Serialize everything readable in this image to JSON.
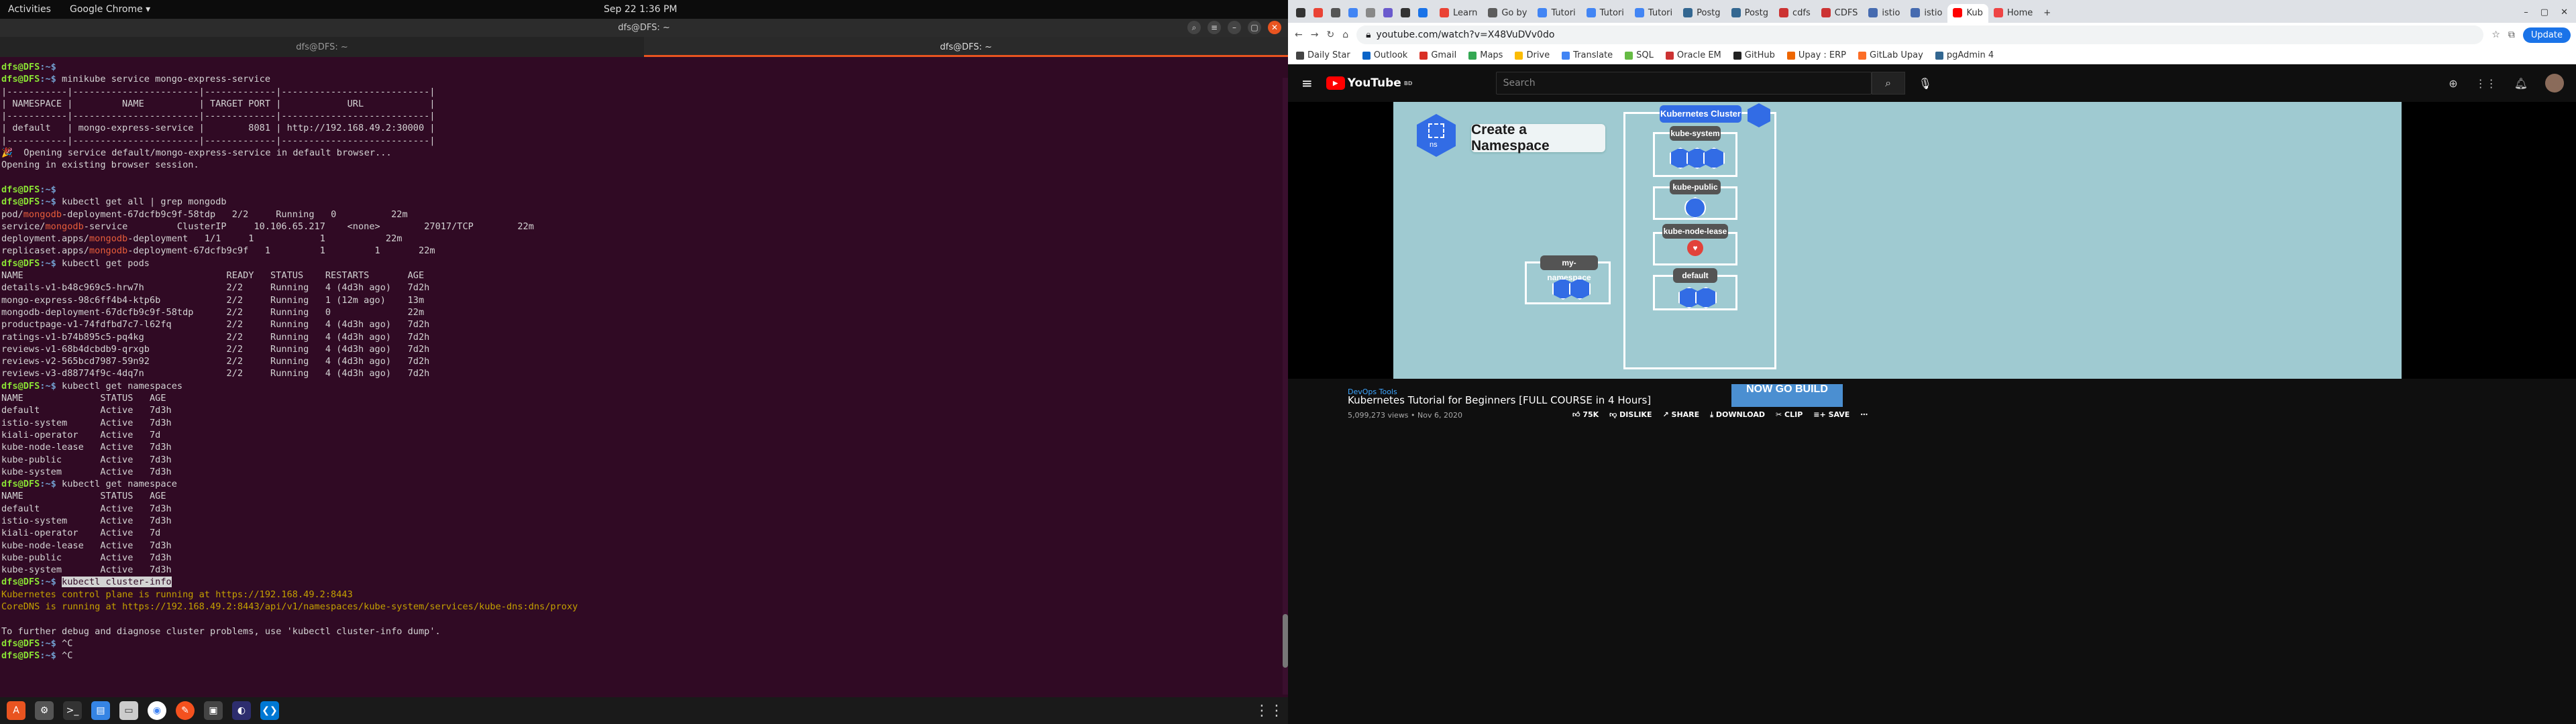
{
  "topbar": {
    "activities": "Activities",
    "app": "Google Chrome ▾",
    "clock": "Sep 22  1:36 PM",
    "tray": "●"
  },
  "terminal": {
    "title": "dfs@DFS: ~",
    "tabs": [
      "dfs@DFS: ~",
      "dfs@DFS: ~"
    ],
    "prompt_user": "dfs@DFS",
    "prompt_path": ":~$",
    "lines": [
      {
        "p": true,
        "cmd": ""
      },
      {
        "p": true,
        "cmd": " minikube service mongo-express-service"
      },
      {
        "t": "|-----------|-----------------------|-------------|---------------------------|"
      },
      {
        "t": "| NAMESPACE |         NAME          | TARGET PORT |            URL            |"
      },
      {
        "t": "|-----------|-----------------------|-------------|---------------------------|"
      },
      {
        "t": "| default   | mongo-express-service |        8081 | http://192.168.49.2:30000 |"
      },
      {
        "t": "|-----------|-----------------------|-------------|---------------------------|"
      },
      {
        "t": "🎉  Opening service default/mongo-express-service in default browser..."
      },
      {
        "t": "Opening in existing browser session."
      },
      {
        "t": ""
      },
      {
        "p": true,
        "cmd": ""
      },
      {
        "p": true,
        "cmd": " kubectl get all | grep mongodb"
      },
      {
        "t": "pod/{mongodb}-deployment-67dcfb9c9f-58tdp   2/2     Running   0          22m"
      },
      {
        "t": "service/{mongodb}-service         ClusterIP     10.106.65.217    <none>        27017/TCP        22m"
      },
      {
        "t": "deployment.apps/{mongodb}-deployment   1/1     1            1           22m"
      },
      {
        "t": "replicaset.apps/{mongodb}-deployment-67dcfb9c9f   1         1         1       22m"
      },
      {
        "p": true,
        "cmd": " kubectl get pods"
      },
      {
        "t": "NAME                                     READY   STATUS    RESTARTS       AGE"
      },
      {
        "t": "details-v1-b48c969c5-hrw7h               2/2     Running   4 (4d3h ago)   7d2h"
      },
      {
        "t": "mongo-express-98c6ff4b4-ktp6b            2/2     Running   1 (12m ago)    13m"
      },
      {
        "t": "mongodb-deployment-67dcfb9c9f-58tdp      2/2     Running   0              22m"
      },
      {
        "t": "productpage-v1-74fdfbd7c7-l62fq          2/2     Running   4 (4d3h ago)   7d2h"
      },
      {
        "t": "ratings-v1-b74b895c5-pq4kg               2/2     Running   4 (4d3h ago)   7d2h"
      },
      {
        "t": "reviews-v1-68b4dcbdb9-qrxgb              2/2     Running   4 (4d3h ago)   7d2h"
      },
      {
        "t": "reviews-v2-565bcd7987-59n92              2/2     Running   4 (4d3h ago)   7d2h"
      },
      {
        "t": "reviews-v3-d88774f9c-4dq7n               2/2     Running   4 (4d3h ago)   7d2h"
      },
      {
        "p": true,
        "cmd": " kubectl get namespaces"
      },
      {
        "t": "NAME              STATUS   AGE"
      },
      {
        "t": "default           Active   7d3h"
      },
      {
        "t": "istio-system      Active   7d3h"
      },
      {
        "t": "kiali-operator    Active   7d"
      },
      {
        "t": "kube-node-lease   Active   7d3h"
      },
      {
        "t": "kube-public       Active   7d3h"
      },
      {
        "t": "kube-system       Active   7d3h"
      },
      {
        "p": true,
        "cmd": " kubectl get namespace"
      },
      {
        "t": "NAME              STATUS   AGE"
      },
      {
        "t": "default           Active   7d3h"
      },
      {
        "t": "istio-system      Active   7d3h"
      },
      {
        "t": "kiali-operator    Active   7d"
      },
      {
        "t": "kube-node-lease   Active   7d3h"
      },
      {
        "t": "kube-public       Active   7d3h"
      },
      {
        "t": "kube-system       Active   7d3h"
      },
      {
        "p": true,
        "cmd": " ",
        "sel": "kubectl cluster-info"
      },
      {
        "t": "Kubernetes control plane is running at https://192.168.49.2:8443",
        "u": true
      },
      {
        "t": "CoreDNS is running at https://192.168.49.2:8443/api/v1/namespaces/kube-system/services/kube-dns:dns/proxy",
        "u": true
      },
      {
        "t": ""
      },
      {
        "t": "To further debug and diagnose cluster problems, use 'kubectl cluster-info dump'."
      },
      {
        "p": true,
        "cmd": " ^C"
      },
      {
        "p": true,
        "cmd": " ^C"
      },
      {
        "p": true,
        "cmd": " ▯"
      }
    ]
  },
  "chrome": {
    "tabs": [
      "Learn",
      "Go by",
      "Tutori",
      "Tutori",
      "Tutori",
      "Postg",
      "Postg",
      "cdfs",
      "CDFS",
      "istio",
      "istio",
      "Kub",
      "Home"
    ],
    "active_tab_index": 11,
    "address": "youtube.com/watch?v=X48VuDVv0do",
    "update": "Update",
    "bookmarks": [
      {
        "label": "Daily Star",
        "color": "#444"
      },
      {
        "label": "Outlook",
        "color": "#0a64c8"
      },
      {
        "label": "Gmail",
        "color": "#d93025"
      },
      {
        "label": "Maps",
        "color": "#34a853"
      },
      {
        "label": "Drive",
        "color": "#fbbc04"
      },
      {
        "label": "Translate",
        "color": "#4285f4"
      },
      {
        "label": "SQL",
        "color": "#6b4"
      },
      {
        "label": "Oracle EM",
        "color": "#c33"
      },
      {
        "label": "GitHub",
        "color": "#222"
      },
      {
        "label": "Upay : ERP",
        "color": "#e60"
      },
      {
        "label": "GitLab Upay",
        "color": "#fc6d26"
      },
      {
        "label": "pgAdmin 4",
        "color": "#336791"
      }
    ]
  },
  "youtube": {
    "logo": "YouTube",
    "logo_sup": "BD",
    "search_placeholder": "Search",
    "video": {
      "ns_label": "ns",
      "title": "Create a Namespace",
      "cluster_label": "Kubernetes Cluster",
      "namespaces": [
        "kube-system",
        "kube-public",
        "kube-node-lease",
        "default"
      ],
      "my_namespace": "my-namespace"
    },
    "channel": "DevOps Tools",
    "title": "Kubernetes Tutorial for Beginners [FULL COURSE in 4 Hours]",
    "meta": "5,099,273 views • Nov 6, 2020",
    "actions": [
      "75K",
      "DISLIKE",
      "SHARE",
      "DOWNLOAD",
      "CLIP",
      "SAVE",
      "⋯"
    ],
    "ad_text": "NOW GO BUILD"
  }
}
